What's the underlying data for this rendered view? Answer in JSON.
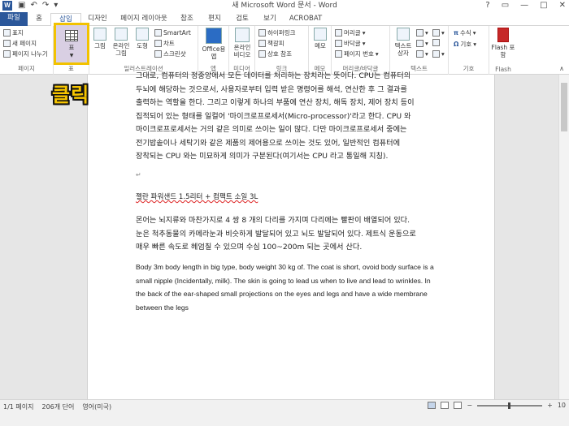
{
  "window": {
    "title": "새 Microsoft Word 문서 - Word",
    "app_icon": "W",
    "qat": [
      "save-icon",
      "undo-icon",
      "redo-icon",
      "customize-icon"
    ],
    "controls": [
      "?",
      "□",
      "—",
      "□",
      "✕"
    ]
  },
  "tabs": [
    {
      "label": "파일",
      "type": "file"
    },
    {
      "label": "홈",
      "type": "normal"
    },
    {
      "label": "삽입",
      "type": "active"
    },
    {
      "label": "디자인",
      "type": "normal"
    },
    {
      "label": "페이지 레이아웃",
      "type": "normal"
    },
    {
      "label": "참조",
      "type": "normal"
    },
    {
      "label": "편지",
      "type": "normal"
    },
    {
      "label": "검토",
      "type": "normal"
    },
    {
      "label": "보기",
      "type": "normal"
    },
    {
      "label": "ACROBAT",
      "type": "normal"
    }
  ],
  "ribbon": {
    "pages": {
      "label": "페이지",
      "items": [
        "표지",
        "새 페이지",
        "페이지 나누기"
      ]
    },
    "table": {
      "label": "표",
      "button": "표"
    },
    "illustrations": {
      "label": "일러스트레이션",
      "items": [
        "그림",
        "온라인 그림",
        "도형"
      ],
      "small": [
        "SmartArt",
        "차트",
        "스크린샷"
      ]
    },
    "apps": {
      "label": "앱",
      "items": [
        "Office용 앱"
      ]
    },
    "media": {
      "label": "미디어",
      "items": [
        "온라인 비디오"
      ]
    },
    "links": {
      "label": "링크",
      "items": [
        "하이퍼링크",
        "책갈피",
        "상호 참조"
      ]
    },
    "comments": {
      "label": "메모",
      "items": [
        "메모"
      ]
    },
    "header_footer": {
      "label": "머리글/바닥글",
      "items": [
        "머리글",
        "바닥글",
        "페이지 번호"
      ]
    },
    "text": {
      "label": "텍스트",
      "items": [
        "텍스트 상자"
      ]
    },
    "symbols": {
      "label": "기호",
      "items": [
        "수식",
        "기호"
      ]
    },
    "flash": {
      "label": "Flash",
      "items": [
        "Flash 포함"
      ]
    }
  },
  "annotation": "클릭",
  "document": {
    "para1": [
      "그대로, 컴퓨터의 정중앙에서 모든 데이터를 처리하는 장치라는 뜻이다. CPU는 컴퓨터의",
      "두뇌에 해당하는 것으로서, 사용자로부터 입력 받은 명령어를 해석, 연산한 후 그 결과를",
      "출력하는 역할을 한다. 그리고 이렇게 하나의 부품에 연산 장치, 해독 장치, 제어 장치 등이",
      "집적되어 있는 형태를 일컬어 '마이크로프로세서(Micro-processor)'라고 한다. CPU 와",
      "마이크로프로세서는 거의 같은 의미로 쓰이는 일이 많다. 다만 마이크로프로세서 중에는",
      "전기밥솥이나 세탁기와 같은 제품의 제어용으로 쓰이는 것도 있어, 일반적인 컴퓨터에",
      "장착되는 CPU 와는 미묘하게 의미가 구분된다(여기서는 CPU 라고 통일해 지칭)."
    ],
    "heading": "젤란 파워샌드 1.5리터 + 컴팩트 소일 3L",
    "para2": [
      "몬어는 뇌지류와 마찬가지로 4 쌍 8 개의 다리를 가지며 다리에는 빨판이 배열되어 있다.",
      "눈은 척추동물의 카메라눈과 비슷하게 발달되어 있고 뇌도 발달되어 있다. 제트식 운동으로",
      "매우 빠른 속도로 헤엄칠 수 있으며 수심 100~200m 되는 곳에서 산다."
    ],
    "para3": [
      "Body 3m body length in big type, body weight 30 kg of. The coat is short, ovoid body surface is a",
      "small nipple (Incidentally, milk). The skin is going to lead us when to live and lead to wrinkles. In",
      "the back of the ear-shaped small projections on the eyes and legs and have a wide membrane",
      "between the legs"
    ]
  },
  "status": {
    "page": "1/1 페이지",
    "words": "206개 단어",
    "lang": "영어(미국)",
    "zoom_end": "10"
  }
}
